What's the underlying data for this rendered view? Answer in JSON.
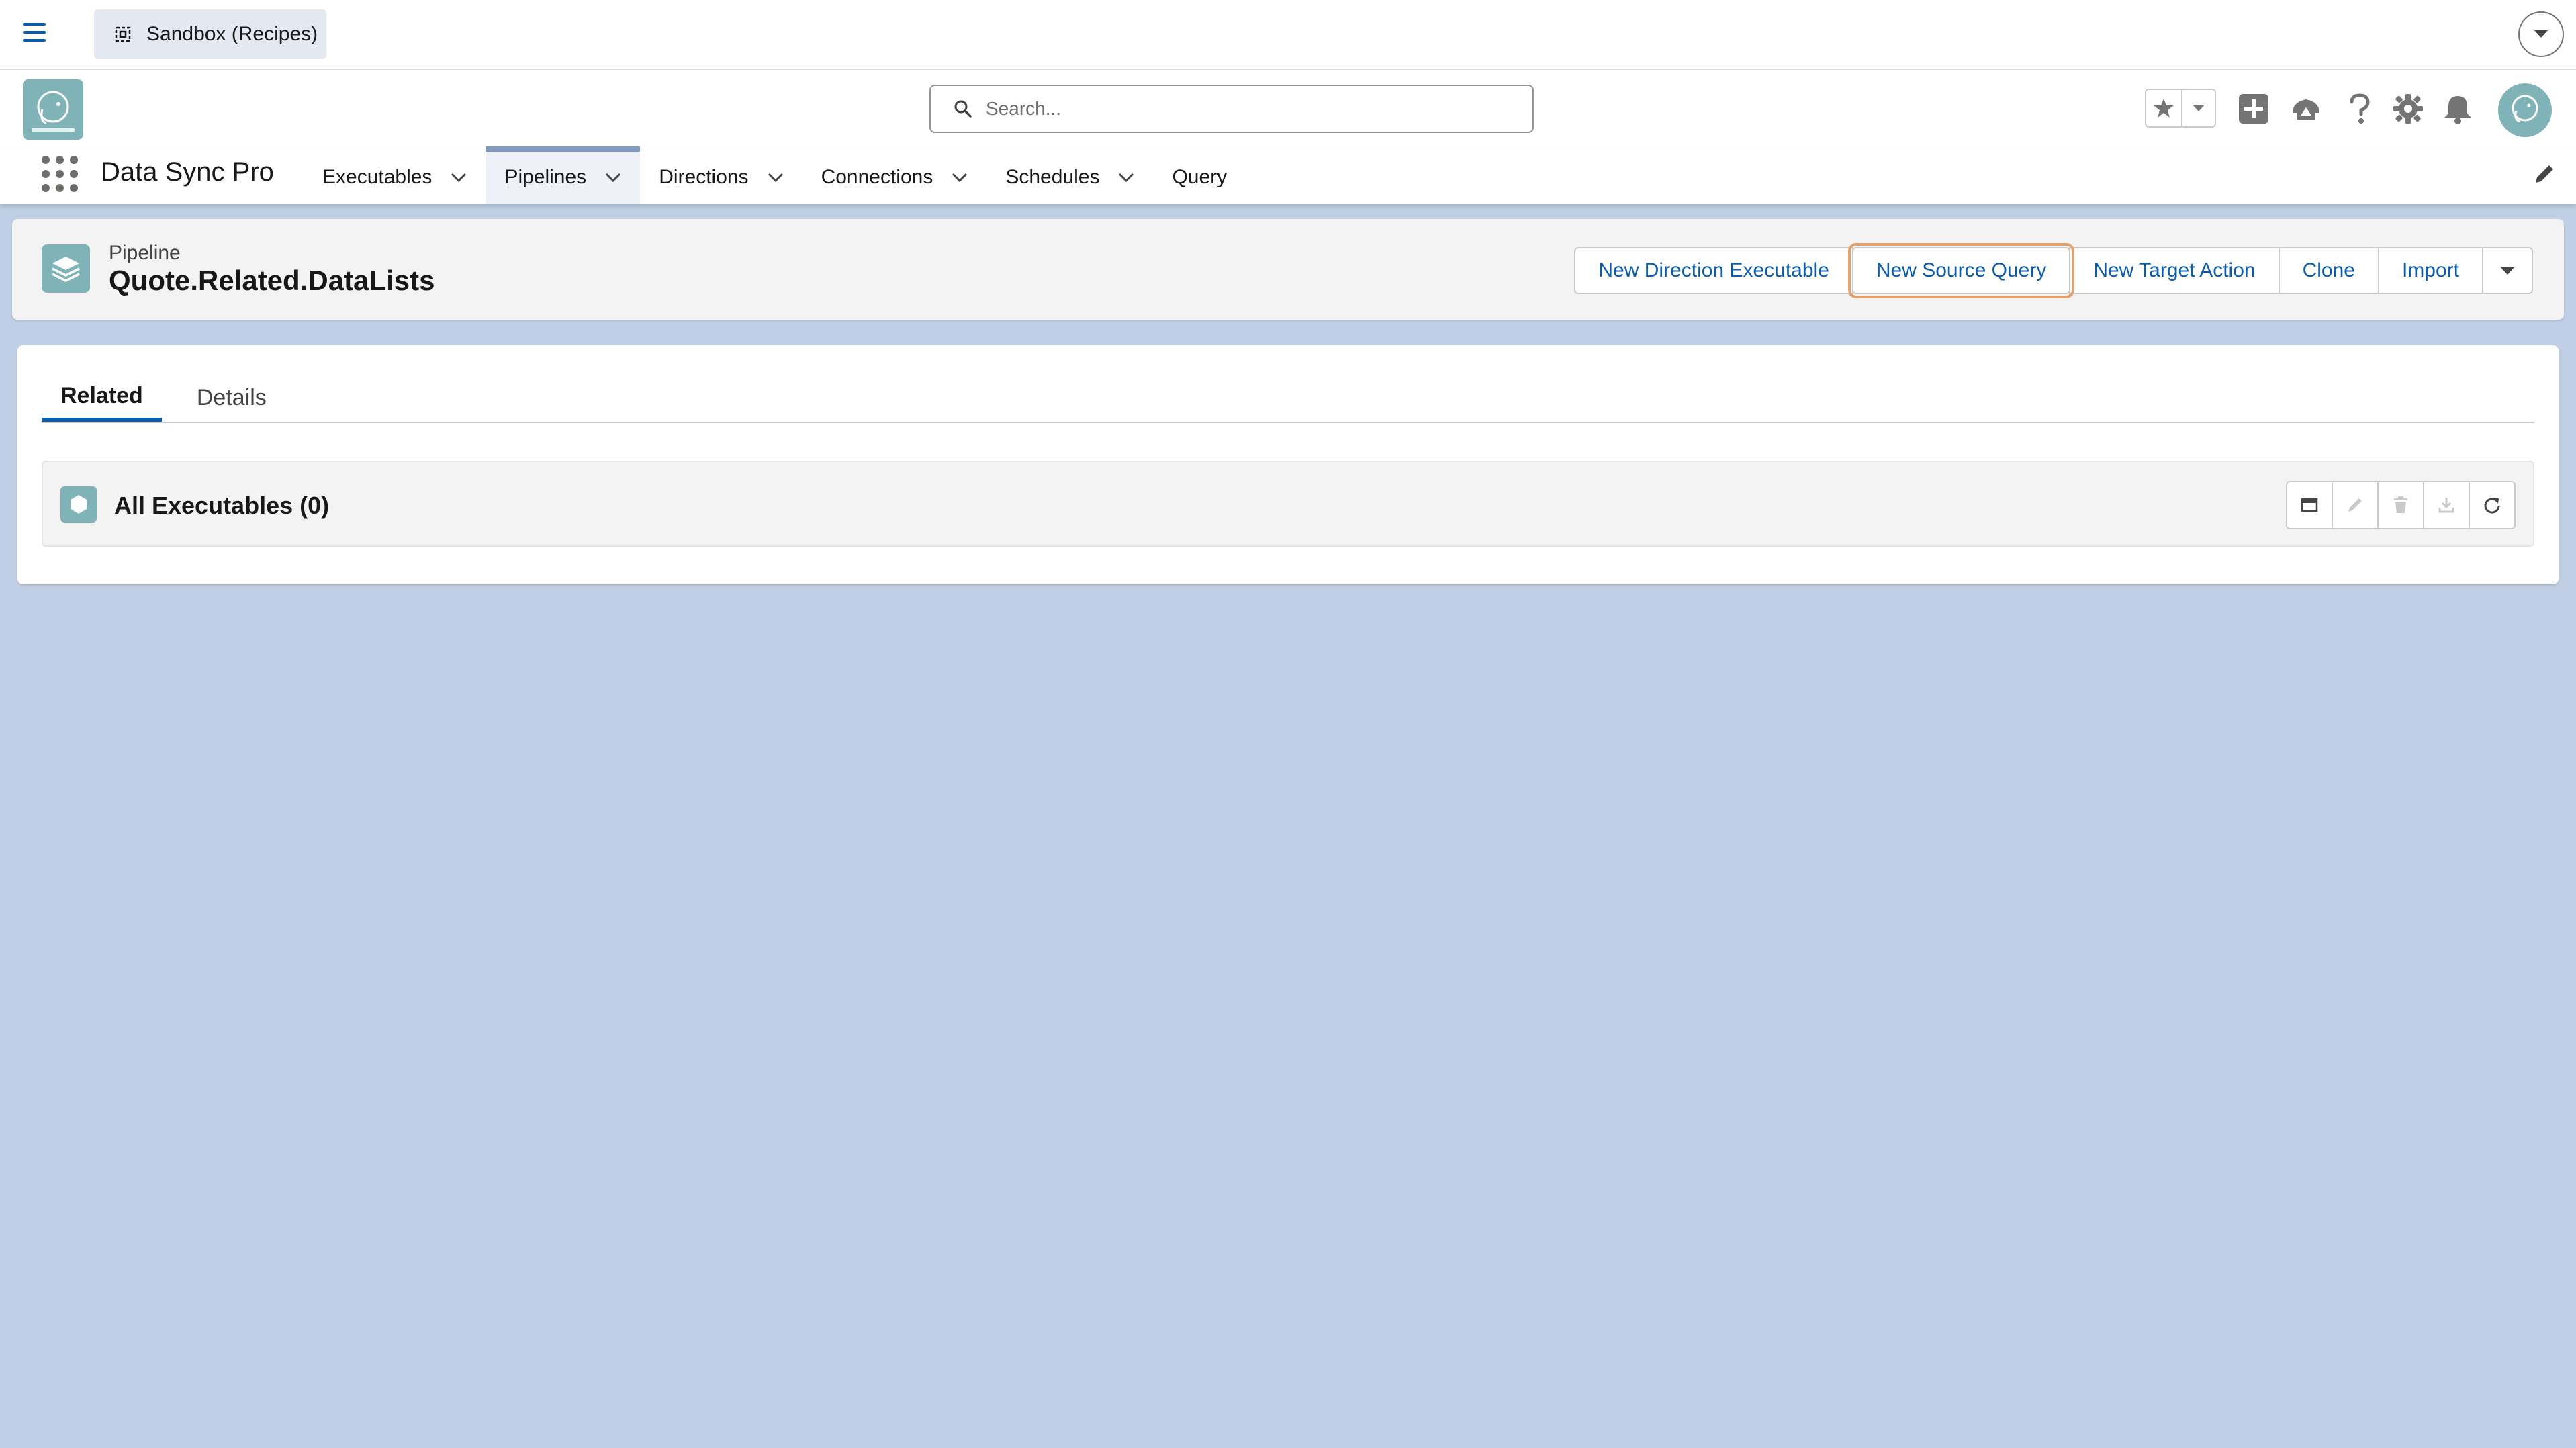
{
  "topbar": {
    "environment_label": "Sandbox (Recipes)"
  },
  "header": {
    "app_name": "Data Sync Pro",
    "search_placeholder": "Search...",
    "logo_icon": "data-sync-pro-logo",
    "icons": [
      "star-icon",
      "add-icon",
      "trailhead-icon",
      "help-icon",
      "setup-gear-icon",
      "bell-icon",
      "avatar"
    ]
  },
  "nav": {
    "items": [
      {
        "label": "Executables",
        "has_menu": true,
        "active": false
      },
      {
        "label": "Pipelines",
        "has_menu": true,
        "active": true
      },
      {
        "label": "Directions",
        "has_menu": true,
        "active": false
      },
      {
        "label": "Connections",
        "has_menu": true,
        "active": false
      },
      {
        "label": "Schedules",
        "has_menu": true,
        "active": false
      },
      {
        "label": "Query",
        "has_menu": false,
        "active": false
      }
    ]
  },
  "record": {
    "type": "Pipeline",
    "name": "Quote.Related.DataLists",
    "actions": {
      "new_direction_executable": "New Direction Executable",
      "new_source_query": "New Source Query",
      "new_target_action": "New Target Action",
      "clone": "Clone",
      "import": "Import"
    }
  },
  "tabs": {
    "related": "Related",
    "details": "Details",
    "active": "Related"
  },
  "related_list": {
    "title": "All Executables (0)",
    "count": 0
  },
  "colors": {
    "background": "#c0cfe5",
    "brand_blue": "#0b5cab",
    "highlight_outline": "#e0a16e",
    "icon_teal": "#7fb3b8"
  }
}
